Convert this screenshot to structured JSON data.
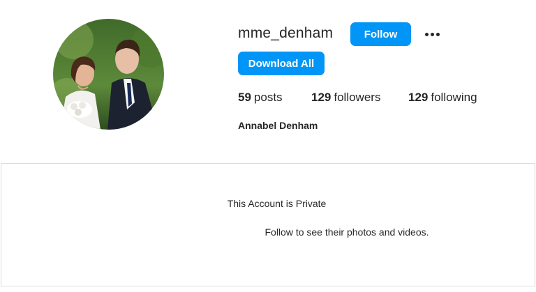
{
  "profile": {
    "username": "mme_denham",
    "full_name": "Annabel Denham",
    "avatar_icon": "profile-photo-couple"
  },
  "actions": {
    "follow_label": "Follow",
    "download_label": "Download All",
    "more_icon": "more-options-icon"
  },
  "stats": {
    "posts_count": "59",
    "posts_label": "posts",
    "followers_count": "129",
    "followers_label": "followers",
    "following_count": "129",
    "following_label": "following"
  },
  "private_notice": {
    "title": "This Account is Private",
    "subtitle": "Follow to see their photos and videos."
  },
  "colors": {
    "accent": "#0095f6",
    "text": "#262626",
    "border": "#dbdbdb"
  }
}
